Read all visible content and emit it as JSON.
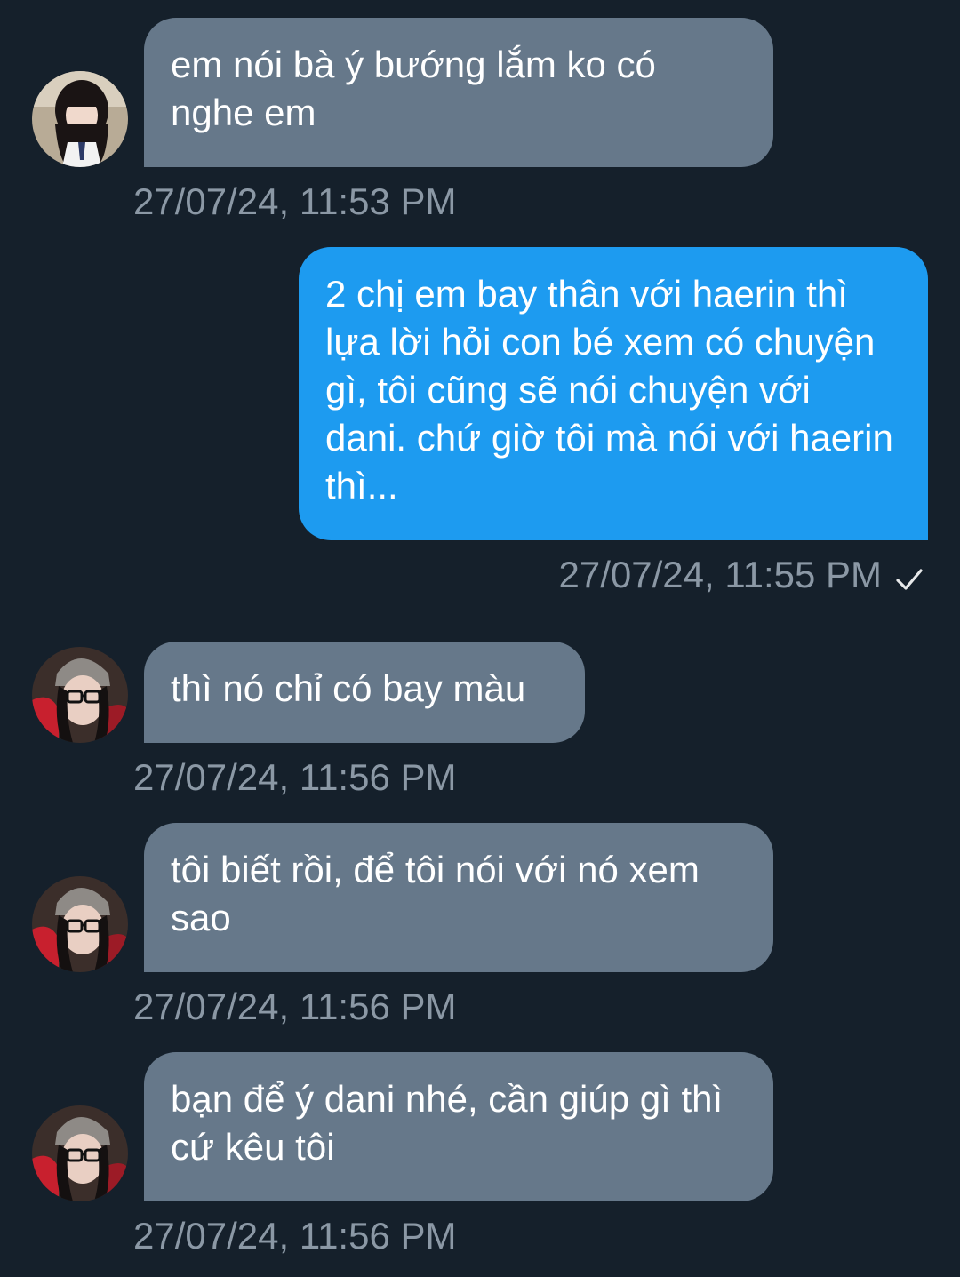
{
  "conversation": {
    "messages": [
      {
        "sender": "them",
        "avatar": "avatar-girl-bangs",
        "text": "em nói bà ý bướng lắm ko có nghe em",
        "time": "27/07/24, 11:53 PM"
      },
      {
        "sender": "me",
        "text": "2 chị em bay thân với haerin thì lựa lời hỏi con bé xem có chuyện gì, tôi cũng sẽ nói chuyện với dani. chứ giờ tôi mà nói với haerin thì...",
        "time": "27/07/24, 11:55 PM",
        "status_icon": "check-icon"
      },
      {
        "sender": "them",
        "avatar": "avatar-girl-beanie-glasses",
        "text": "thì nó chỉ có bay màu",
        "time": "27/07/24, 11:56 PM"
      },
      {
        "sender": "them",
        "avatar": "avatar-girl-beanie-glasses",
        "text": "tôi biết rồi, để tôi nói với nó xem sao",
        "time": "27/07/24, 11:56 PM"
      },
      {
        "sender": "them",
        "avatar": "avatar-girl-beanie-glasses",
        "text": "bạn để ý dani nhé, cần giúp gì thì cứ kêu tôi",
        "time": "27/07/24, 11:56 PM"
      }
    ]
  },
  "colors": {
    "background": "#15202b",
    "incoming_bubble": "#66788a",
    "outgoing_bubble": "#1d9bf0",
    "timestamp": "#8b98a5"
  }
}
